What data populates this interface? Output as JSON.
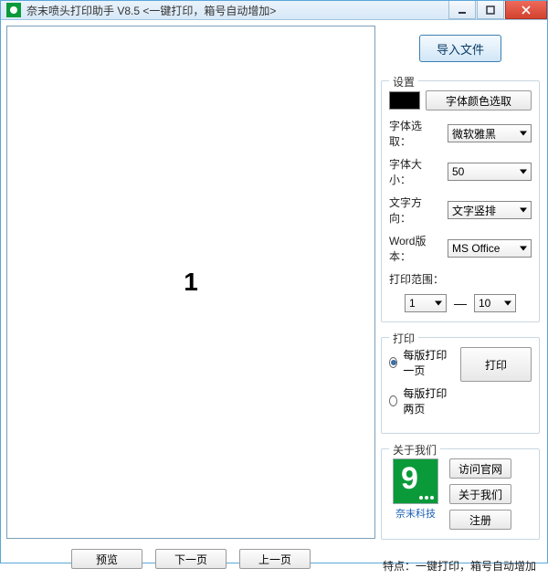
{
  "window": {
    "title": "奈末喷头打印助手 V8.5   <一键打印，箱号自动增加>"
  },
  "preview": {
    "page_number": "1"
  },
  "buttons": {
    "preview": "预览",
    "next": "下一页",
    "prev": "上一页",
    "import": "导入文件"
  },
  "settings": {
    "legend": "设置",
    "color_pick": "字体颜色选取",
    "font_label": "字体选取：",
    "font_value": "微软雅黑",
    "size_label": "字体大小：",
    "size_value": "50",
    "dir_label": "文字方向：",
    "dir_value": "文字竖排",
    "word_label": "Word版本：",
    "word_value": "MS Office",
    "range_label": "打印范围：",
    "range_from": "1",
    "range_to": "10"
  },
  "print": {
    "legend": "打印",
    "opt1": "每版打印一页",
    "opt2": "每版打印两页",
    "selected": 0,
    "button": "打印"
  },
  "about": {
    "legend": "关于我们",
    "logo_label": "奈末科技",
    "site": "访问官网",
    "aboutus": "关于我们",
    "register": "注册"
  },
  "features": "特点：一键打印，箱号自动增加"
}
